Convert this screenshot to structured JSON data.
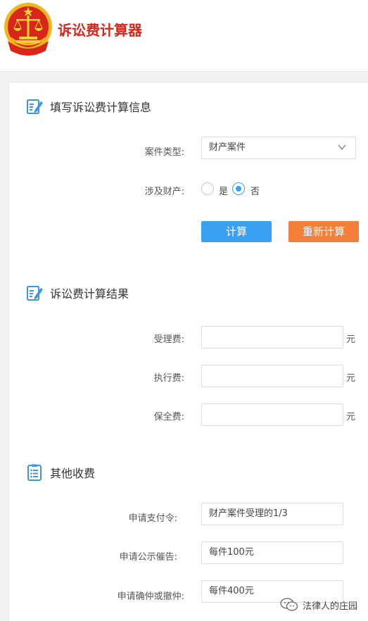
{
  "header": {
    "title": "诉讼费计算器"
  },
  "colors": {
    "brand_red": "#d8261a",
    "primary_blue": "#3aa0f0",
    "accent_orange": "#f47f3a",
    "icon_blue": "#3b95e0"
  },
  "form_section": {
    "icon": "edit-doc-icon",
    "title": "填写诉讼费计算信息",
    "case_type_label": "案件类型:",
    "case_type_value": "财产案件",
    "property_label": "涉及财产:",
    "option_yes": "是",
    "option_no": "否",
    "selected_option": "否",
    "calc_button": "计算",
    "reset_button": "重新计算"
  },
  "result_section": {
    "icon": "edit-doc-icon",
    "title": "诉讼费计算结果",
    "rows": [
      {
        "label": "受理费:",
        "value": "",
        "unit": "元"
      },
      {
        "label": "执行费:",
        "value": "",
        "unit": "元"
      },
      {
        "label": "保全费:",
        "value": "",
        "unit": "元"
      }
    ]
  },
  "other_section": {
    "icon": "list-doc-icon",
    "title": "其他收费",
    "rows": [
      {
        "label": "申请支付令:",
        "value": "财产案件受理的1/3"
      },
      {
        "label": "申请公示催告:",
        "value": "每件100元"
      },
      {
        "label": "申请确仲或撤仲:",
        "value": "每件400元"
      }
    ]
  },
  "watermark": {
    "text": "法律人的庄园",
    "icon": "wechat-icon"
  }
}
